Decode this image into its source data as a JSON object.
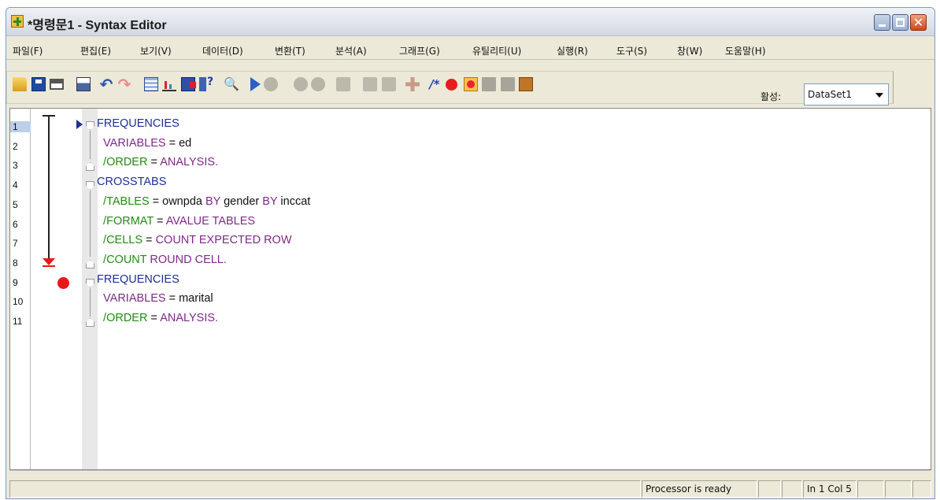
{
  "window": {
    "title": "*명령문1 - Syntax Editor",
    "close_glyph": "✕"
  },
  "menu": [
    "파일(F)",
    "편집(E)",
    "보기(V)",
    "데이터(D)",
    "변환(T)",
    "분석(A)",
    "그래프(G)",
    "유틸리티(U)",
    "실행(R)",
    "도구(S)",
    "창(W)",
    "도움말(H)"
  ],
  "toolbar": {
    "icons": [
      "open-folder-icon",
      "save-icon",
      "print-icon",
      "dialog-recall-icon",
      "undo-icon",
      "redo-icon",
      "goto-data-icon",
      "chart-icon",
      "variables-icon",
      "variable-info-icon",
      "find-icon",
      "run-icon",
      "stop-icon",
      "toggle-icon",
      "gray-icon",
      "split-icon",
      "filter-icon",
      "append-icon",
      "plus-icon",
      "comment-icon",
      "breakpoint-icon",
      "clear-breakpoint-icon",
      "bookmark-icon",
      "bookmark-next-icon",
      "bookmark-clear-icon"
    ],
    "find_glyph": "🔍",
    "undo_glyph": "↶",
    "redo_glyph": "↷",
    "comment_glyph": "/*",
    "active_label": "활성:",
    "dataset": "DataSet1"
  },
  "editor": {
    "lines": [
      {
        "n": "1",
        "tokens": [
          {
            "t": "FREQUENCIES",
            "c": "kw"
          }
        ]
      },
      {
        "n": "2",
        "tokens": [
          {
            "t": "  VARIABLES",
            "c": "val"
          },
          {
            "t": " = ed",
            "c": "plain"
          }
        ]
      },
      {
        "n": "3",
        "tokens": [
          {
            "t": "  /ORDER",
            "c": "sub"
          },
          {
            "t": " = ",
            "c": "plain"
          },
          {
            "t": "ANALYSIS.",
            "c": "val"
          }
        ]
      },
      {
        "n": "4",
        "tokens": [
          {
            "t": "CROSSTABS",
            "c": "kw"
          }
        ]
      },
      {
        "n": "5",
        "tokens": [
          {
            "t": "  /TABLES",
            "c": "sub"
          },
          {
            "t": " = ownpda ",
            "c": "plain"
          },
          {
            "t": "BY",
            "c": "val"
          },
          {
            "t": " gender ",
            "c": "plain"
          },
          {
            "t": "BY",
            "c": "val"
          },
          {
            "t": " inccat",
            "c": "plain"
          }
        ]
      },
      {
        "n": "6",
        "tokens": [
          {
            "t": "  /FORMAT",
            "c": "sub"
          },
          {
            "t": " = ",
            "c": "plain"
          },
          {
            "t": "AVALUE TABLES",
            "c": "val"
          }
        ]
      },
      {
        "n": "7",
        "tokens": [
          {
            "t": "  /CELLS",
            "c": "sub"
          },
          {
            "t": " = ",
            "c": "plain"
          },
          {
            "t": "COUNT EXPECTED ROW",
            "c": "val"
          }
        ]
      },
      {
        "n": "8",
        "tokens": [
          {
            "t": "  /COUNT",
            "c": "sub"
          },
          {
            "t": " ROUND CELL.",
            "c": "val"
          }
        ]
      },
      {
        "n": "9",
        "tokens": [
          {
            "t": "FREQUENCIES",
            "c": "kw"
          }
        ]
      },
      {
        "n": "10",
        "tokens": [
          {
            "t": "  VARIABLES",
            "c": "val"
          },
          {
            "t": " = marital",
            "c": "plain"
          }
        ]
      },
      {
        "n": "11",
        "tokens": [
          {
            "t": "  /ORDER",
            "c": "sub"
          },
          {
            "t": " = ",
            "c": "plain"
          },
          {
            "t": "ANALYSIS.",
            "c": "val"
          }
        ]
      }
    ],
    "current_line": "1",
    "breakpoint_line": "9"
  },
  "status": {
    "processor": "Processor is ready",
    "position": "In 1 Col 5"
  }
}
